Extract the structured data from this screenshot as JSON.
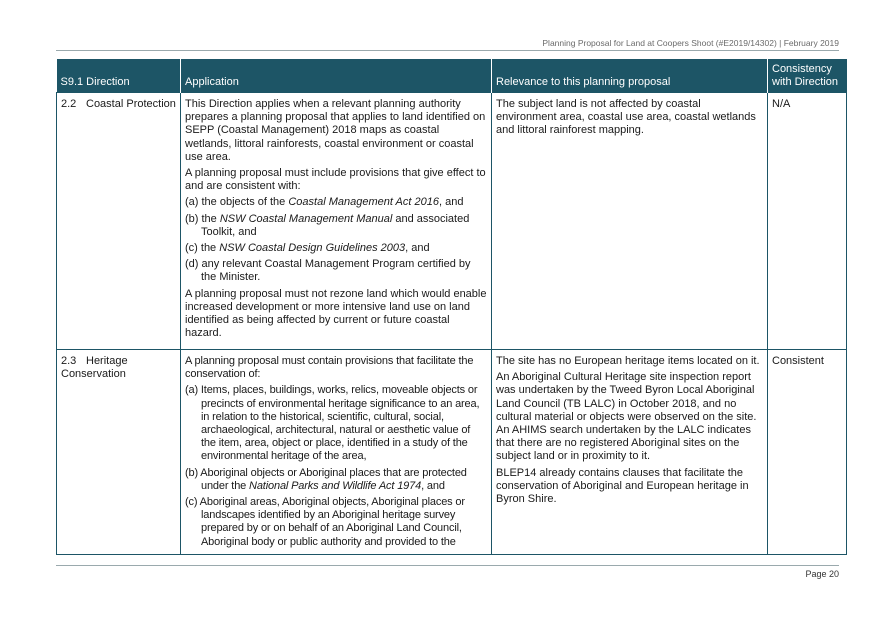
{
  "header": {
    "text": "Planning Proposal for Land at Coopers Shoot (#E2019/14302)   |   February 2019"
  },
  "table": {
    "columns": [
      "S9.1 Direction",
      "Application",
      "Relevance to this planning proposal",
      "Consistency with Direction"
    ],
    "rows": [
      {
        "direction_num": "2.2",
        "direction_title": "Coastal Protection",
        "application": {
          "p1": "This Direction applies when a relevant planning authority prepares a planning proposal that applies to land identified on SEPP (Coastal Management) 2018 maps as coastal wetlands, littoral rainforests, coastal environment or coastal use area.",
          "p2": "A planning proposal must include provisions that give effect to and are consistent with:",
          "a_pre": "(a) the objects of the ",
          "a_em": "Coastal Management Act 2016",
          "a_post": ", and",
          "b_pre": "(b) the ",
          "b_em": "NSW Coastal Management Manual",
          "b_post": " and associated Toolkit, and",
          "c_pre": "(c) the ",
          "c_em": "NSW Coastal Design Guidelines 2003",
          "c_post": ", and",
          "d": "(d) any relevant Coastal Management Program certified by the Minister.",
          "p3": "A planning proposal must not rezone land which would enable increased development or more intensive land use on land identified as being affected by current or future coastal hazard."
        },
        "relevance": {
          "p1": "The subject land is not affected by coastal environment area, coastal use area, coastal wetlands and littoral rainforest mapping."
        },
        "consistency": "N/A"
      },
      {
        "direction_num": "2.3",
        "direction_title": "Heritage Conservation",
        "application": {
          "p1": "A planning proposal must contain provisions that facilitate the conservation of:",
          "a": "(a) Items, places, buildings, works, relics, moveable objects or precincts of environmental heritage significance to an area, in relation to the historical, scientific, cultural, social, archaeological, architectural, natural or aesthetic value of the item, area, object or place, identified in a study of the environmental heritage of the area,",
          "b_pre": "(b) Aboriginal objects or Aboriginal places that are protected under the ",
          "b_em": "National Parks and Wildlife Act 1974",
          "b_post": ", and",
          "c": "(c) Aboriginal areas, Aboriginal objects, Aboriginal places or landscapes identified by an Aboriginal heritage survey prepared by or on behalf of an Aboriginal Land Council, Aboriginal body or public authority and provided to the"
        },
        "relevance": {
          "p1": "The site has no European heritage items located on it.",
          "p2": "An Aboriginal Cultural Heritage site inspection report was undertaken by the Tweed Byron Local Aboriginal Land Council (TB LALC) in October 2018, and no cultural material or objects were observed on the site.  An AHIMS search undertaken by the LALC indicates that there are no registered Aboriginal sites on the subject land or in proximity to it.",
          "p3": "BLEP14 already contains clauses that facilitate the conservation of Aboriginal and European heritage in Byron Shire."
        },
        "consistency": "Consistent"
      }
    ]
  },
  "footer": {
    "page": "Page 20"
  }
}
